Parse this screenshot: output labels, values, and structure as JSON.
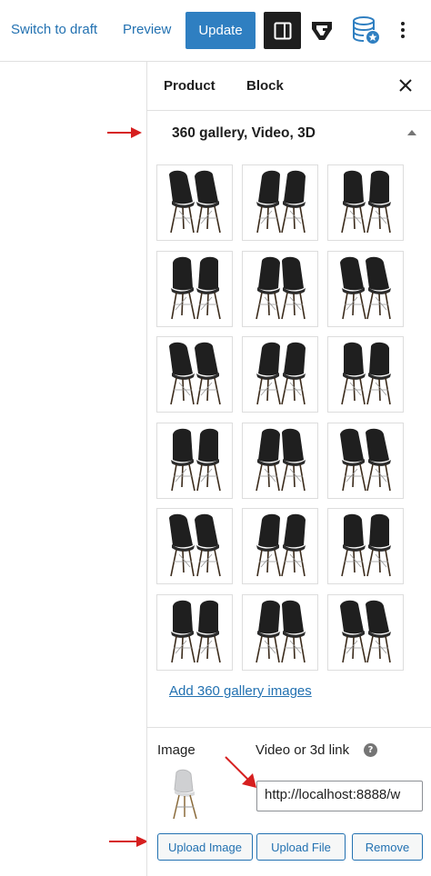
{
  "toolbar": {
    "switch_to_draft": "Switch to draft",
    "preview": "Preview",
    "update": "Update",
    "icons": [
      "settings-sidebar-icon",
      "g-plugin-icon",
      "database-icon",
      "more-options-icon"
    ],
    "accent_color": "#2f7fc1"
  },
  "sidebar": {
    "tabs": [
      {
        "label": "Product",
        "active": true
      },
      {
        "label": "Block",
        "active": false
      }
    ],
    "close_icon": "close-icon",
    "panel": {
      "title": "360 gallery, Video, 3D",
      "expanded": true,
      "gallery_count": 18,
      "add_link": "Add 360 gallery images"
    },
    "media": {
      "image_label": "Image",
      "video_label": "Video or 3d link",
      "help_icon": "?",
      "url_value": "http://localhost:8888/w",
      "buttons": {
        "upload_image": "Upload Image",
        "upload_file": "Upload File",
        "remove": "Remove"
      }
    }
  },
  "annotations": {
    "arrow_color": "#d61f1f"
  }
}
